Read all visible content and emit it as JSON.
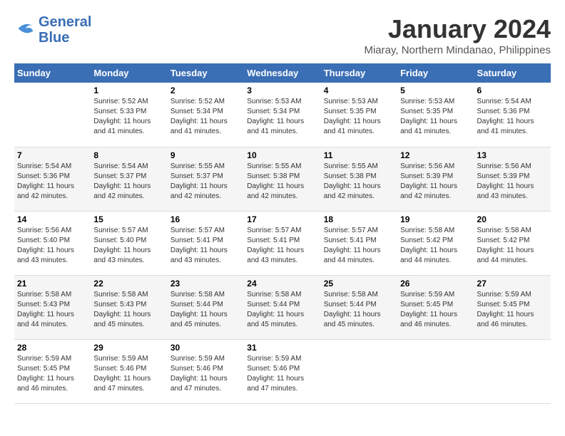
{
  "logo": {
    "line1": "General",
    "line2": "Blue"
  },
  "title": "January 2024",
  "location": "Miaray, Northern Mindanao, Philippines",
  "days_of_week": [
    "Sunday",
    "Monday",
    "Tuesday",
    "Wednesday",
    "Thursday",
    "Friday",
    "Saturday"
  ],
  "weeks": [
    [
      {
        "day": "",
        "info": ""
      },
      {
        "day": "1",
        "info": "Sunrise: 5:52 AM\nSunset: 5:33 PM\nDaylight: 11 hours\nand 41 minutes."
      },
      {
        "day": "2",
        "info": "Sunrise: 5:52 AM\nSunset: 5:34 PM\nDaylight: 11 hours\nand 41 minutes."
      },
      {
        "day": "3",
        "info": "Sunrise: 5:53 AM\nSunset: 5:34 PM\nDaylight: 11 hours\nand 41 minutes."
      },
      {
        "day": "4",
        "info": "Sunrise: 5:53 AM\nSunset: 5:35 PM\nDaylight: 11 hours\nand 41 minutes."
      },
      {
        "day": "5",
        "info": "Sunrise: 5:53 AM\nSunset: 5:35 PM\nDaylight: 11 hours\nand 41 minutes."
      },
      {
        "day": "6",
        "info": "Sunrise: 5:54 AM\nSunset: 5:36 PM\nDaylight: 11 hours\nand 41 minutes."
      }
    ],
    [
      {
        "day": "7",
        "info": "Sunrise: 5:54 AM\nSunset: 5:36 PM\nDaylight: 11 hours\nand 42 minutes."
      },
      {
        "day": "8",
        "info": "Sunrise: 5:54 AM\nSunset: 5:37 PM\nDaylight: 11 hours\nand 42 minutes."
      },
      {
        "day": "9",
        "info": "Sunrise: 5:55 AM\nSunset: 5:37 PM\nDaylight: 11 hours\nand 42 minutes."
      },
      {
        "day": "10",
        "info": "Sunrise: 5:55 AM\nSunset: 5:38 PM\nDaylight: 11 hours\nand 42 minutes."
      },
      {
        "day": "11",
        "info": "Sunrise: 5:55 AM\nSunset: 5:38 PM\nDaylight: 11 hours\nand 42 minutes."
      },
      {
        "day": "12",
        "info": "Sunrise: 5:56 AM\nSunset: 5:39 PM\nDaylight: 11 hours\nand 42 minutes."
      },
      {
        "day": "13",
        "info": "Sunrise: 5:56 AM\nSunset: 5:39 PM\nDaylight: 11 hours\nand 43 minutes."
      }
    ],
    [
      {
        "day": "14",
        "info": "Sunrise: 5:56 AM\nSunset: 5:40 PM\nDaylight: 11 hours\nand 43 minutes."
      },
      {
        "day": "15",
        "info": "Sunrise: 5:57 AM\nSunset: 5:40 PM\nDaylight: 11 hours\nand 43 minutes."
      },
      {
        "day": "16",
        "info": "Sunrise: 5:57 AM\nSunset: 5:41 PM\nDaylight: 11 hours\nand 43 minutes."
      },
      {
        "day": "17",
        "info": "Sunrise: 5:57 AM\nSunset: 5:41 PM\nDaylight: 11 hours\nand 43 minutes."
      },
      {
        "day": "18",
        "info": "Sunrise: 5:57 AM\nSunset: 5:41 PM\nDaylight: 11 hours\nand 44 minutes."
      },
      {
        "day": "19",
        "info": "Sunrise: 5:58 AM\nSunset: 5:42 PM\nDaylight: 11 hours\nand 44 minutes."
      },
      {
        "day": "20",
        "info": "Sunrise: 5:58 AM\nSunset: 5:42 PM\nDaylight: 11 hours\nand 44 minutes."
      }
    ],
    [
      {
        "day": "21",
        "info": "Sunrise: 5:58 AM\nSunset: 5:43 PM\nDaylight: 11 hours\nand 44 minutes."
      },
      {
        "day": "22",
        "info": "Sunrise: 5:58 AM\nSunset: 5:43 PM\nDaylight: 11 hours\nand 45 minutes."
      },
      {
        "day": "23",
        "info": "Sunrise: 5:58 AM\nSunset: 5:44 PM\nDaylight: 11 hours\nand 45 minutes."
      },
      {
        "day": "24",
        "info": "Sunrise: 5:58 AM\nSunset: 5:44 PM\nDaylight: 11 hours\nand 45 minutes."
      },
      {
        "day": "25",
        "info": "Sunrise: 5:58 AM\nSunset: 5:44 PM\nDaylight: 11 hours\nand 45 minutes."
      },
      {
        "day": "26",
        "info": "Sunrise: 5:59 AM\nSunset: 5:45 PM\nDaylight: 11 hours\nand 46 minutes."
      },
      {
        "day": "27",
        "info": "Sunrise: 5:59 AM\nSunset: 5:45 PM\nDaylight: 11 hours\nand 46 minutes."
      }
    ],
    [
      {
        "day": "28",
        "info": "Sunrise: 5:59 AM\nSunset: 5:45 PM\nDaylight: 11 hours\nand 46 minutes."
      },
      {
        "day": "29",
        "info": "Sunrise: 5:59 AM\nSunset: 5:46 PM\nDaylight: 11 hours\nand 47 minutes."
      },
      {
        "day": "30",
        "info": "Sunrise: 5:59 AM\nSunset: 5:46 PM\nDaylight: 11 hours\nand 47 minutes."
      },
      {
        "day": "31",
        "info": "Sunrise: 5:59 AM\nSunset: 5:46 PM\nDaylight: 11 hours\nand 47 minutes."
      },
      {
        "day": "",
        "info": ""
      },
      {
        "day": "",
        "info": ""
      },
      {
        "day": "",
        "info": ""
      }
    ]
  ]
}
